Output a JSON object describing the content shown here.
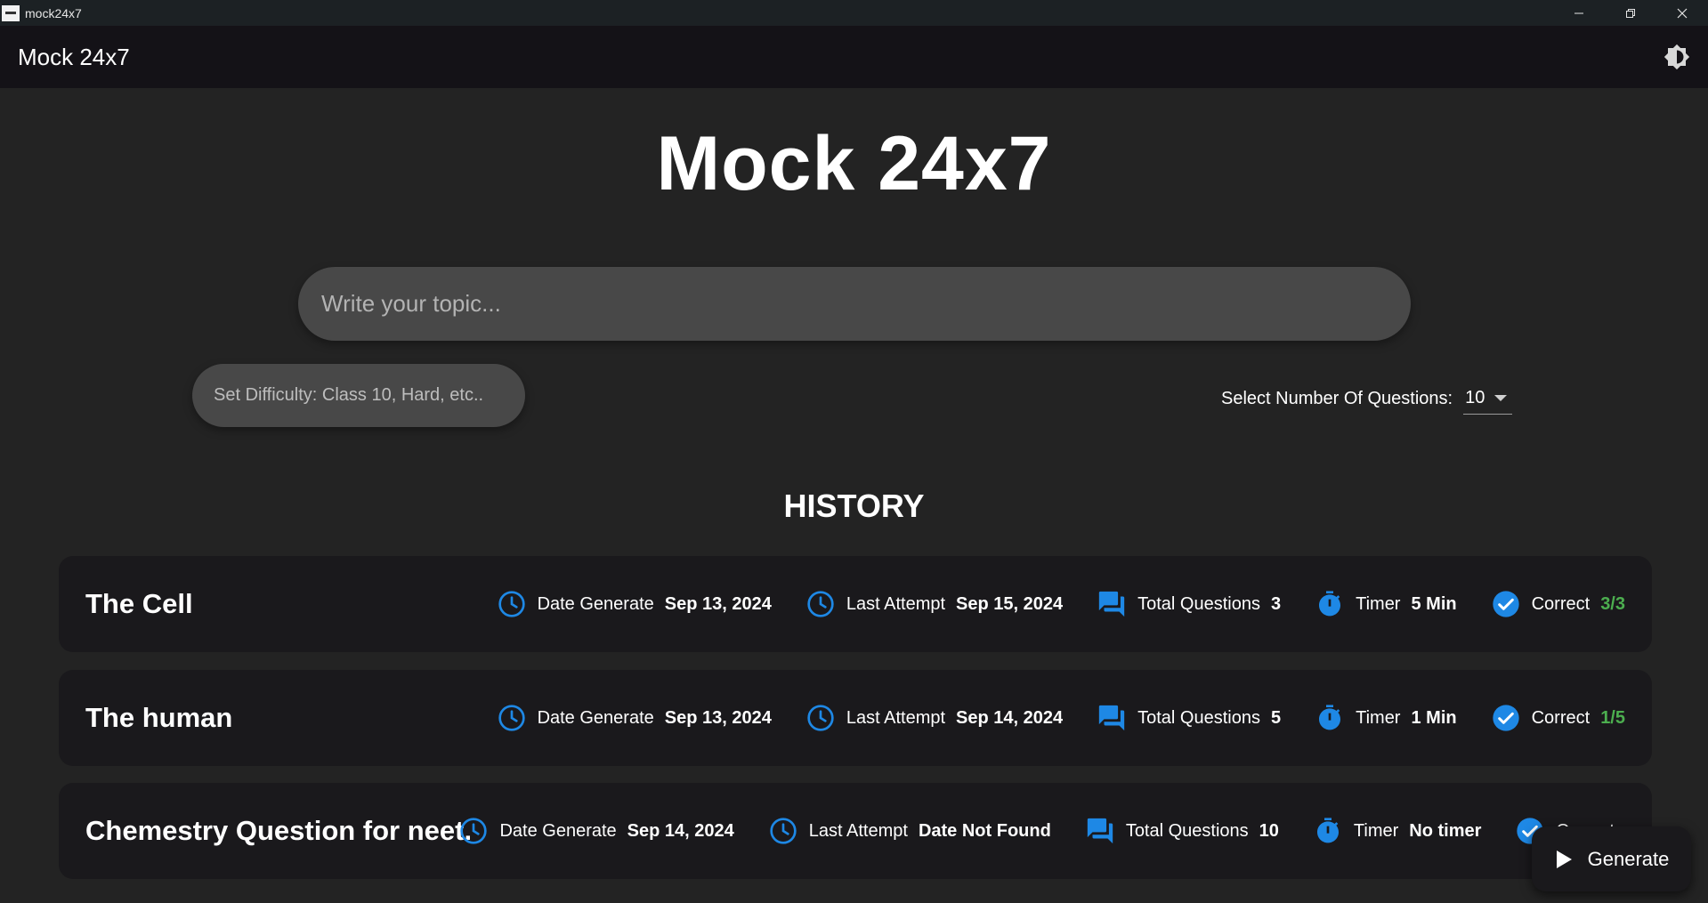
{
  "os_window": {
    "title": "mock24x7",
    "minimize_icon": "minimize-icon",
    "restore_icon": "restore-icon",
    "close_icon": "close-icon"
  },
  "appbar": {
    "title": "Mock 24x7",
    "theme_icon": "brightness-icon"
  },
  "hero": {
    "title": "Mock 24x7"
  },
  "topic_input": {
    "placeholder": "Write your topic...",
    "value": ""
  },
  "difficulty_input": {
    "placeholder": "Set Difficulty: Class 10, Hard, etc..",
    "value": ""
  },
  "question_count": {
    "label": "Select Number Of Questions:",
    "selected": "10"
  },
  "history": {
    "title": "HISTORY",
    "labels": {
      "date_generate": "Date Generate",
      "last_attempt": "Last Attempt",
      "total_questions": "Total Questions",
      "timer": "Timer",
      "correct": "Correct"
    },
    "items": [
      {
        "title": "The Cell",
        "date_generate": "Sep 13, 2024",
        "last_attempt": "Sep 15, 2024",
        "total_questions": "3",
        "timer": "5 Min",
        "correct": "3/3"
      },
      {
        "title": "The human",
        "date_generate": "Sep 13, 2024",
        "last_attempt": "Sep 14, 2024",
        "total_questions": "5",
        "timer": "1 Min",
        "correct": "1/5"
      },
      {
        "title": "Chemestry Question for neet.",
        "date_generate": "Sep 14, 2024",
        "last_attempt": "Date Not Found",
        "total_questions": "10",
        "timer": "No timer",
        "correct": "Correct"
      }
    ]
  },
  "generate_button": {
    "label": "Generate",
    "icon": "play-icon"
  },
  "colors": {
    "icon_blue": "#1e88e5",
    "correct_green": "#4cae4f",
    "background": "#232323",
    "card": "#1a191c"
  }
}
